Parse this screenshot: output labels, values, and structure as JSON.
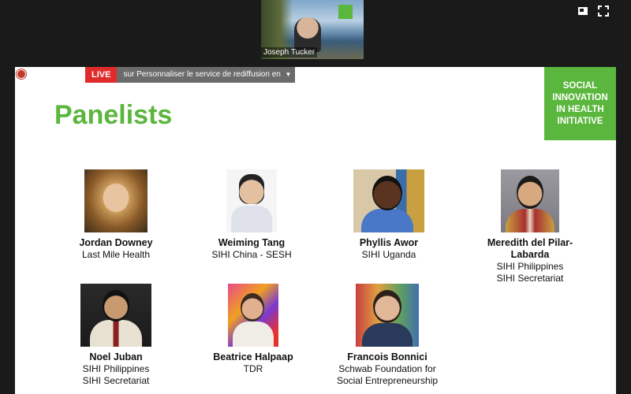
{
  "video": {
    "participant_name": "Joseph Tucker"
  },
  "toolbar": {
    "view_icon": "view-toggle-icon",
    "fullscreen_icon": "fullscreen-icon"
  },
  "live": {
    "badge": "LIVE",
    "selector_text": "sur Personnaliser le service de rediffusion en direct"
  },
  "brand": {
    "lines": [
      "SOCIAL",
      "INNOVATION",
      "IN HEALTH",
      "INITIATIVE"
    ],
    "color": "#5ab63c"
  },
  "slide": {
    "title": "Panelists",
    "title_color": "#5ab63c"
  },
  "panelists": [
    {
      "name": "Jordan Downey",
      "org": [
        "Last Mile Health"
      ]
    },
    {
      "name": "Weiming Tang",
      "org": [
        "SIHI China - SESH"
      ]
    },
    {
      "name": "Phyllis Awor",
      "org": [
        "SIHI Uganda"
      ]
    },
    {
      "name": "Meredith del Pilar-\nLabarda",
      "org": [
        "SIHI Philippines",
        "SIHI Secretariat"
      ]
    },
    {
      "name": "Noel Juban",
      "org": [
        "SIHI Philippines",
        "SIHI Secretariat"
      ]
    },
    {
      "name": "Beatrice Halpaap",
      "org": [
        "TDR"
      ]
    },
    {
      "name": "Francois Bonnici",
      "org": [
        "Schwab Foundation for",
        "Social Entrepreneurship"
      ]
    }
  ]
}
